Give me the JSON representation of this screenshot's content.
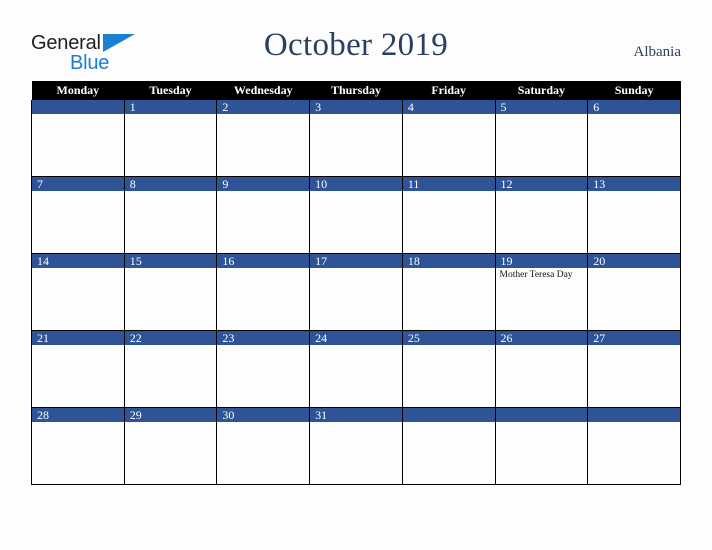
{
  "brand": {
    "name_part1": "General",
    "name_part2": "Blue",
    "triangle_icon": "blue-triangle-icon",
    "colors": {
      "dark_text": "#231f20",
      "blue": "#1b7fd4"
    }
  },
  "header": {
    "title": "October 2019",
    "country": "Albania",
    "title_color": "#2b4061"
  },
  "calendar": {
    "month": "October",
    "year": "2019",
    "weekday_headers": [
      "Monday",
      "Tuesday",
      "Wednesday",
      "Thursday",
      "Friday",
      "Saturday",
      "Sunday"
    ],
    "header_bg": "#000000",
    "daynum_bg": "#2e5396",
    "cell_bg": "#fdfdfd",
    "weeks": [
      [
        {
          "day": "",
          "events": []
        },
        {
          "day": "1",
          "events": []
        },
        {
          "day": "2",
          "events": []
        },
        {
          "day": "3",
          "events": []
        },
        {
          "day": "4",
          "events": []
        },
        {
          "day": "5",
          "events": []
        },
        {
          "day": "6",
          "events": []
        }
      ],
      [
        {
          "day": "7",
          "events": []
        },
        {
          "day": "8",
          "events": []
        },
        {
          "day": "9",
          "events": []
        },
        {
          "day": "10",
          "events": []
        },
        {
          "day": "11",
          "events": []
        },
        {
          "day": "12",
          "events": []
        },
        {
          "day": "13",
          "events": []
        }
      ],
      [
        {
          "day": "14",
          "events": []
        },
        {
          "day": "15",
          "events": []
        },
        {
          "day": "16",
          "events": []
        },
        {
          "day": "17",
          "events": []
        },
        {
          "day": "18",
          "events": []
        },
        {
          "day": "19",
          "events": [
            "Mother Teresa Day"
          ]
        },
        {
          "day": "20",
          "events": []
        }
      ],
      [
        {
          "day": "21",
          "events": []
        },
        {
          "day": "22",
          "events": []
        },
        {
          "day": "23",
          "events": []
        },
        {
          "day": "24",
          "events": []
        },
        {
          "day": "25",
          "events": []
        },
        {
          "day": "26",
          "events": []
        },
        {
          "day": "27",
          "events": []
        }
      ],
      [
        {
          "day": "28",
          "events": []
        },
        {
          "day": "29",
          "events": []
        },
        {
          "day": "30",
          "events": []
        },
        {
          "day": "31",
          "events": []
        },
        {
          "day": "",
          "events": []
        },
        {
          "day": "",
          "events": []
        },
        {
          "day": "",
          "events": []
        }
      ]
    ]
  }
}
